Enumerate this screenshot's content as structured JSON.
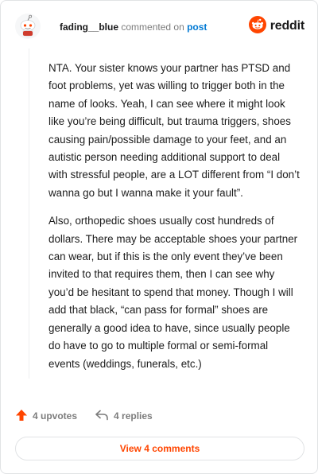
{
  "header": {
    "username": "fading__blue",
    "action_text": "commented on",
    "post_link": "post",
    "brand": "reddit"
  },
  "comment": {
    "paragraphs": [
      "NTA. Your sister knows your partner has PTSD and foot problems, yet was willing to trigger both in the name of looks. Yeah, I can see where it might look like you’re being difficult, but trauma triggers, shoes causing pain/possible damage to your feet, and an autistic person needing additional support to deal with stressful people, are a LOT different from “I don’t wanna go but I wanna make it your fault”.",
      "Also, orthopedic shoes usually cost hundreds of dollars. There may be acceptable shoes your partner can wear, but if this is the only event they’ve been invited to that requires them, then I can see why you’d be hesitant to spend that money. Though I will add that black, “can pass for formal” shoes are generally a good idea to have, since usually people do have to go to multiple formal or semi-formal events (weddings, funerals, etc.)"
    ]
  },
  "actions": {
    "upvotes": "4 upvotes",
    "replies": "4 replies",
    "view_comments": "View 4 comments"
  },
  "colors": {
    "brand_orange": "#ff4500",
    "link_blue": "#0079d3",
    "muted": "#7c7c7c"
  },
  "icons": {
    "avatar": "snoo-avatar-icon",
    "logo": "reddit-logo-icon",
    "upvote": "upvote-arrow-icon",
    "reply": "reply-arrow-icon"
  }
}
